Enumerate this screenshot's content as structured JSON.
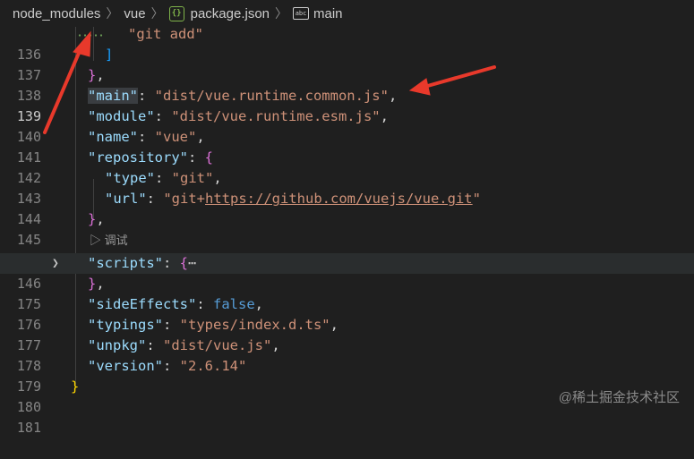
{
  "breadcrumb": {
    "items": [
      "node_modules",
      "vue",
      "package.json",
      "main"
    ],
    "separator": "〉"
  },
  "lines": [
    {
      "num": "136"
    },
    {
      "num": "137"
    },
    {
      "num": "138"
    },
    {
      "num": "139"
    },
    {
      "num": "140"
    },
    {
      "num": "141"
    },
    {
      "num": "142"
    },
    {
      "num": "143"
    },
    {
      "num": "144"
    },
    {
      "num": "145"
    },
    {
      "num": "146"
    },
    {
      "num": "175"
    },
    {
      "num": "176"
    },
    {
      "num": "177"
    },
    {
      "num": "178"
    },
    {
      "num": "179"
    },
    {
      "num": "180"
    },
    {
      "num": "181"
    }
  ],
  "code": {
    "git_add": "\"git add\"",
    "main_key": "\"main\"",
    "main_val": "\"dist/vue.runtime.common.js\"",
    "module_key": "\"module\"",
    "module_val": "\"dist/vue.runtime.esm.js\"",
    "name_key": "\"name\"",
    "name_val": "\"vue\"",
    "repository_key": "\"repository\"",
    "type_key": "\"type\"",
    "type_val": "\"git\"",
    "url_key": "\"url\"",
    "url_open": "\"git+",
    "url_link": "https://github.com/vuejs/vue.git",
    "url_close": "\"",
    "scripts_key": "\"scripts\"",
    "ellipsis": "⋯",
    "sideEffects_key": "\"sideEffects\"",
    "sideEffects_val": "false",
    "typings_key": "\"typings\"",
    "typings_val": "\"types/index.d.ts\"",
    "unpkg_key": "\"unpkg\"",
    "unpkg_val": "\"dist/vue.js\"",
    "version_key": "\"version\"",
    "version_val": "\"2.6.14\""
  },
  "codelens": {
    "label": "调试",
    "icon": "play-icon"
  },
  "watermark": "@稀土掘金技术社区",
  "colors": {
    "background": "#1f1f1f",
    "key": "#9cdcfe",
    "string": "#ce9178",
    "keyword": "#569cd6",
    "bracket_gold": "#ffd700",
    "bracket_purple": "#da70d6",
    "bracket_blue": "#179fff",
    "annotation_arrow": "#e8392b"
  }
}
